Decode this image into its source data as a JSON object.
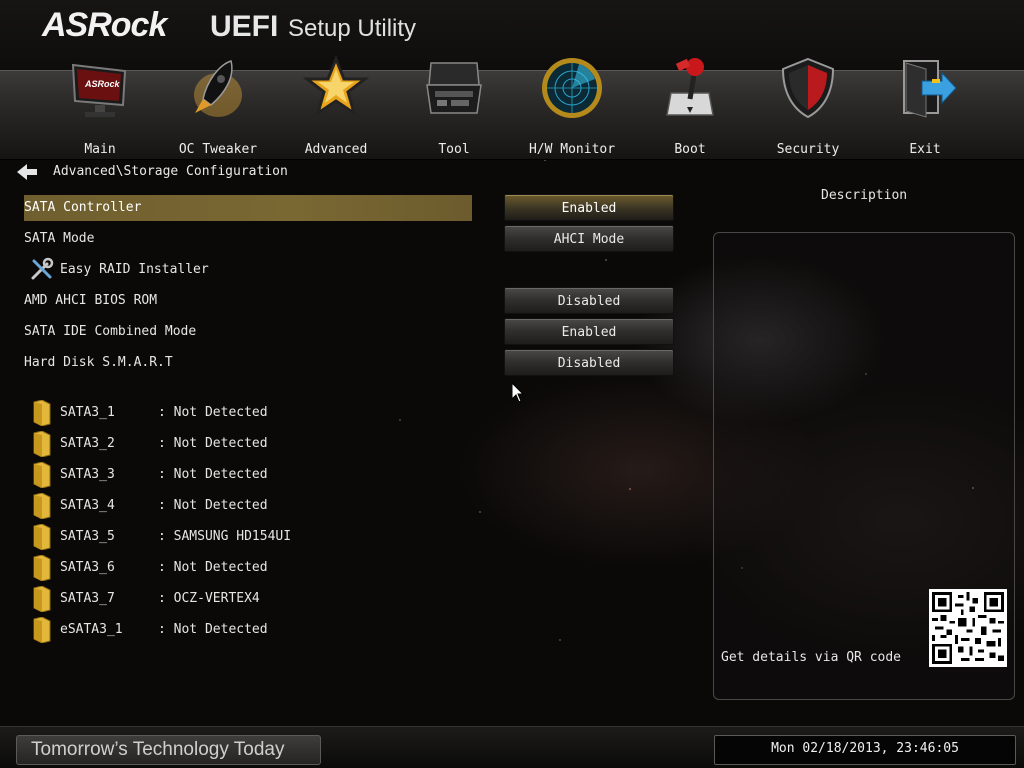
{
  "app": {
    "logo": "ASRock",
    "title_uefi": "UEFI",
    "title_rest": "Setup Utility"
  },
  "nav": {
    "items": [
      {
        "label": "Main",
        "icon": "monitor-icon"
      },
      {
        "label": "OC Tweaker",
        "icon": "rocket-icon"
      },
      {
        "label": "Advanced",
        "icon": "star-icon"
      },
      {
        "label": "Tool",
        "icon": "toolbox-icon"
      },
      {
        "label": "H/W Monitor",
        "icon": "radar-icon"
      },
      {
        "label": "Boot",
        "icon": "joystick-icon"
      },
      {
        "label": "Security",
        "icon": "shield-icon"
      },
      {
        "label": "Exit",
        "icon": "exit-door-icon"
      }
    ]
  },
  "breadcrumb": "Advanced\\Storage Configuration",
  "settings": [
    {
      "label": "SATA Controller",
      "value": "Enabled"
    },
    {
      "label": "SATA Mode",
      "value": "AHCI Mode"
    },
    {
      "label": "Easy RAID Installer",
      "value": ""
    },
    {
      "label": "AMD AHCI BIOS ROM",
      "value": "Disabled"
    },
    {
      "label": "SATA IDE Combined Mode",
      "value": "Enabled"
    },
    {
      "label": "Hard Disk S.M.A.R.T",
      "value": "Disabled"
    }
  ],
  "drives": [
    {
      "name": "SATA3_1",
      "status": ": Not Detected"
    },
    {
      "name": "SATA3_2",
      "status": ": Not Detected"
    },
    {
      "name": "SATA3_3",
      "status": ": Not Detected"
    },
    {
      "name": "SATA3_4",
      "status": ": Not Detected"
    },
    {
      "name": "SATA3_5",
      "status": ": SAMSUNG HD154UI"
    },
    {
      "name": "SATA3_6",
      "status": ": Not Detected"
    },
    {
      "name": "SATA3_7",
      "status": ": OCZ-VERTEX4"
    },
    {
      "name": "eSATA3_1",
      "status": ": Not Detected"
    }
  ],
  "description": {
    "title": "Description",
    "qr_label": "Get details via QR code"
  },
  "footer": {
    "slogan": "Tomorrow’s Technology Today",
    "datetime": "Mon 02/18/2013, 23:46:05"
  },
  "colors": {
    "highlight": "#7a6833",
    "background": "#0a0908",
    "text": "#e6e6e6"
  }
}
